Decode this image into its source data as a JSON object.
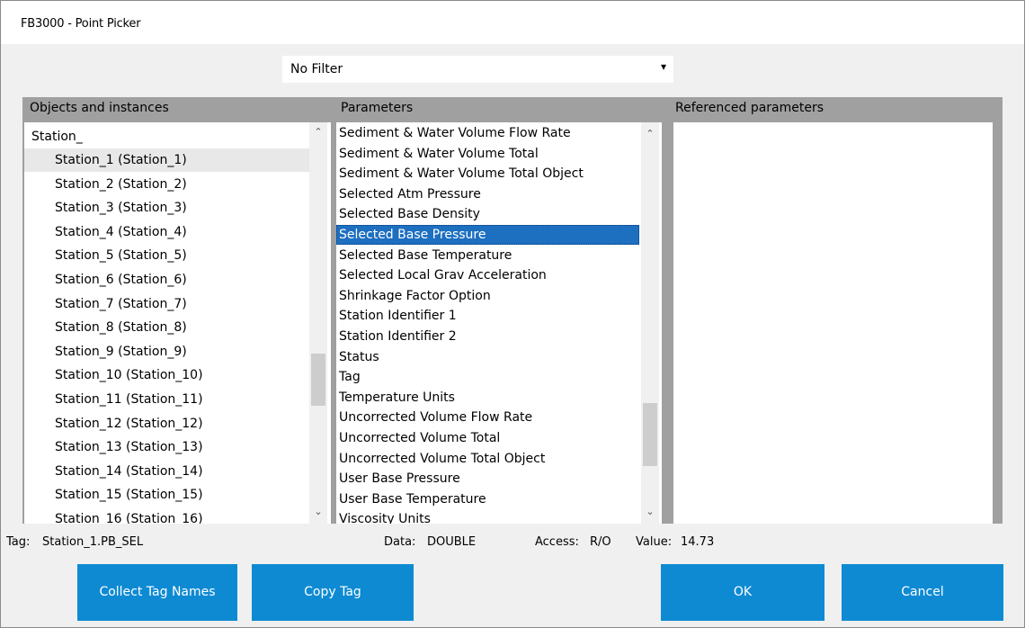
{
  "window": {
    "title": "FB3000 - Point Picker"
  },
  "filter": {
    "value": "No Filter"
  },
  "panels": {
    "objects": {
      "header": "Objects and instances",
      "group": "Station_",
      "items": [
        "Station_1 (Station_1)",
        "Station_2 (Station_2)",
        "Station_3 (Station_3)",
        "Station_4 (Station_4)",
        "Station_5 (Station_5)",
        "Station_6 (Station_6)",
        "Station_7 (Station_7)",
        "Station_8 (Station_8)",
        "Station_9 (Station_9)",
        "Station_10 (Station_10)",
        "Station_11 (Station_11)",
        "Station_12 (Station_12)",
        "Station_13 (Station_13)",
        "Station_14 (Station_14)",
        "Station_15 (Station_15)",
        "Station_16 (Station_16)"
      ],
      "hovered": "Station_1 (Station_1)"
    },
    "parameters": {
      "header": "Parameters",
      "items": [
        "Sediment & Water Volume Flow Rate",
        "Sediment & Water Volume Total",
        "Sediment & Water Volume Total Object",
        "Selected Atm Pressure",
        "Selected Base Density",
        "Selected Base Pressure",
        "Selected Base Temperature",
        "Selected Local Grav Acceleration",
        "Shrinkage Factor Option",
        "Station Identifier 1",
        "Station Identifier 2",
        "Status",
        "Tag",
        "Temperature Units",
        "Uncorrected Volume Flow Rate",
        "Uncorrected Volume Total",
        "Uncorrected Volume Total Object",
        "User Base Pressure",
        "User Base Temperature",
        "Viscosity Units"
      ],
      "selected": "Selected Base Pressure"
    },
    "referenced": {
      "header": "Referenced parameters",
      "items": []
    }
  },
  "status": {
    "tag_label": "Tag:",
    "tag_value": "Station_1.PB_SEL",
    "data_label": "Data:",
    "data_value": "DOUBLE",
    "access_label": "Access:",
    "access_value": "R/O",
    "value_label": "Value:",
    "value_value": "14.73"
  },
  "buttons": {
    "collect": "Collect Tag Names",
    "copy": "Copy Tag",
    "ok": "OK",
    "cancel": "Cancel"
  },
  "colors": {
    "accent": "#0e8ad3",
    "selection": "#1d6fc0",
    "panel": "#a0a0a0"
  },
  "icons": {
    "dropdown": "chevron-down-icon",
    "scroll_up": "chevron-up-icon",
    "scroll_down": "chevron-down-icon"
  }
}
